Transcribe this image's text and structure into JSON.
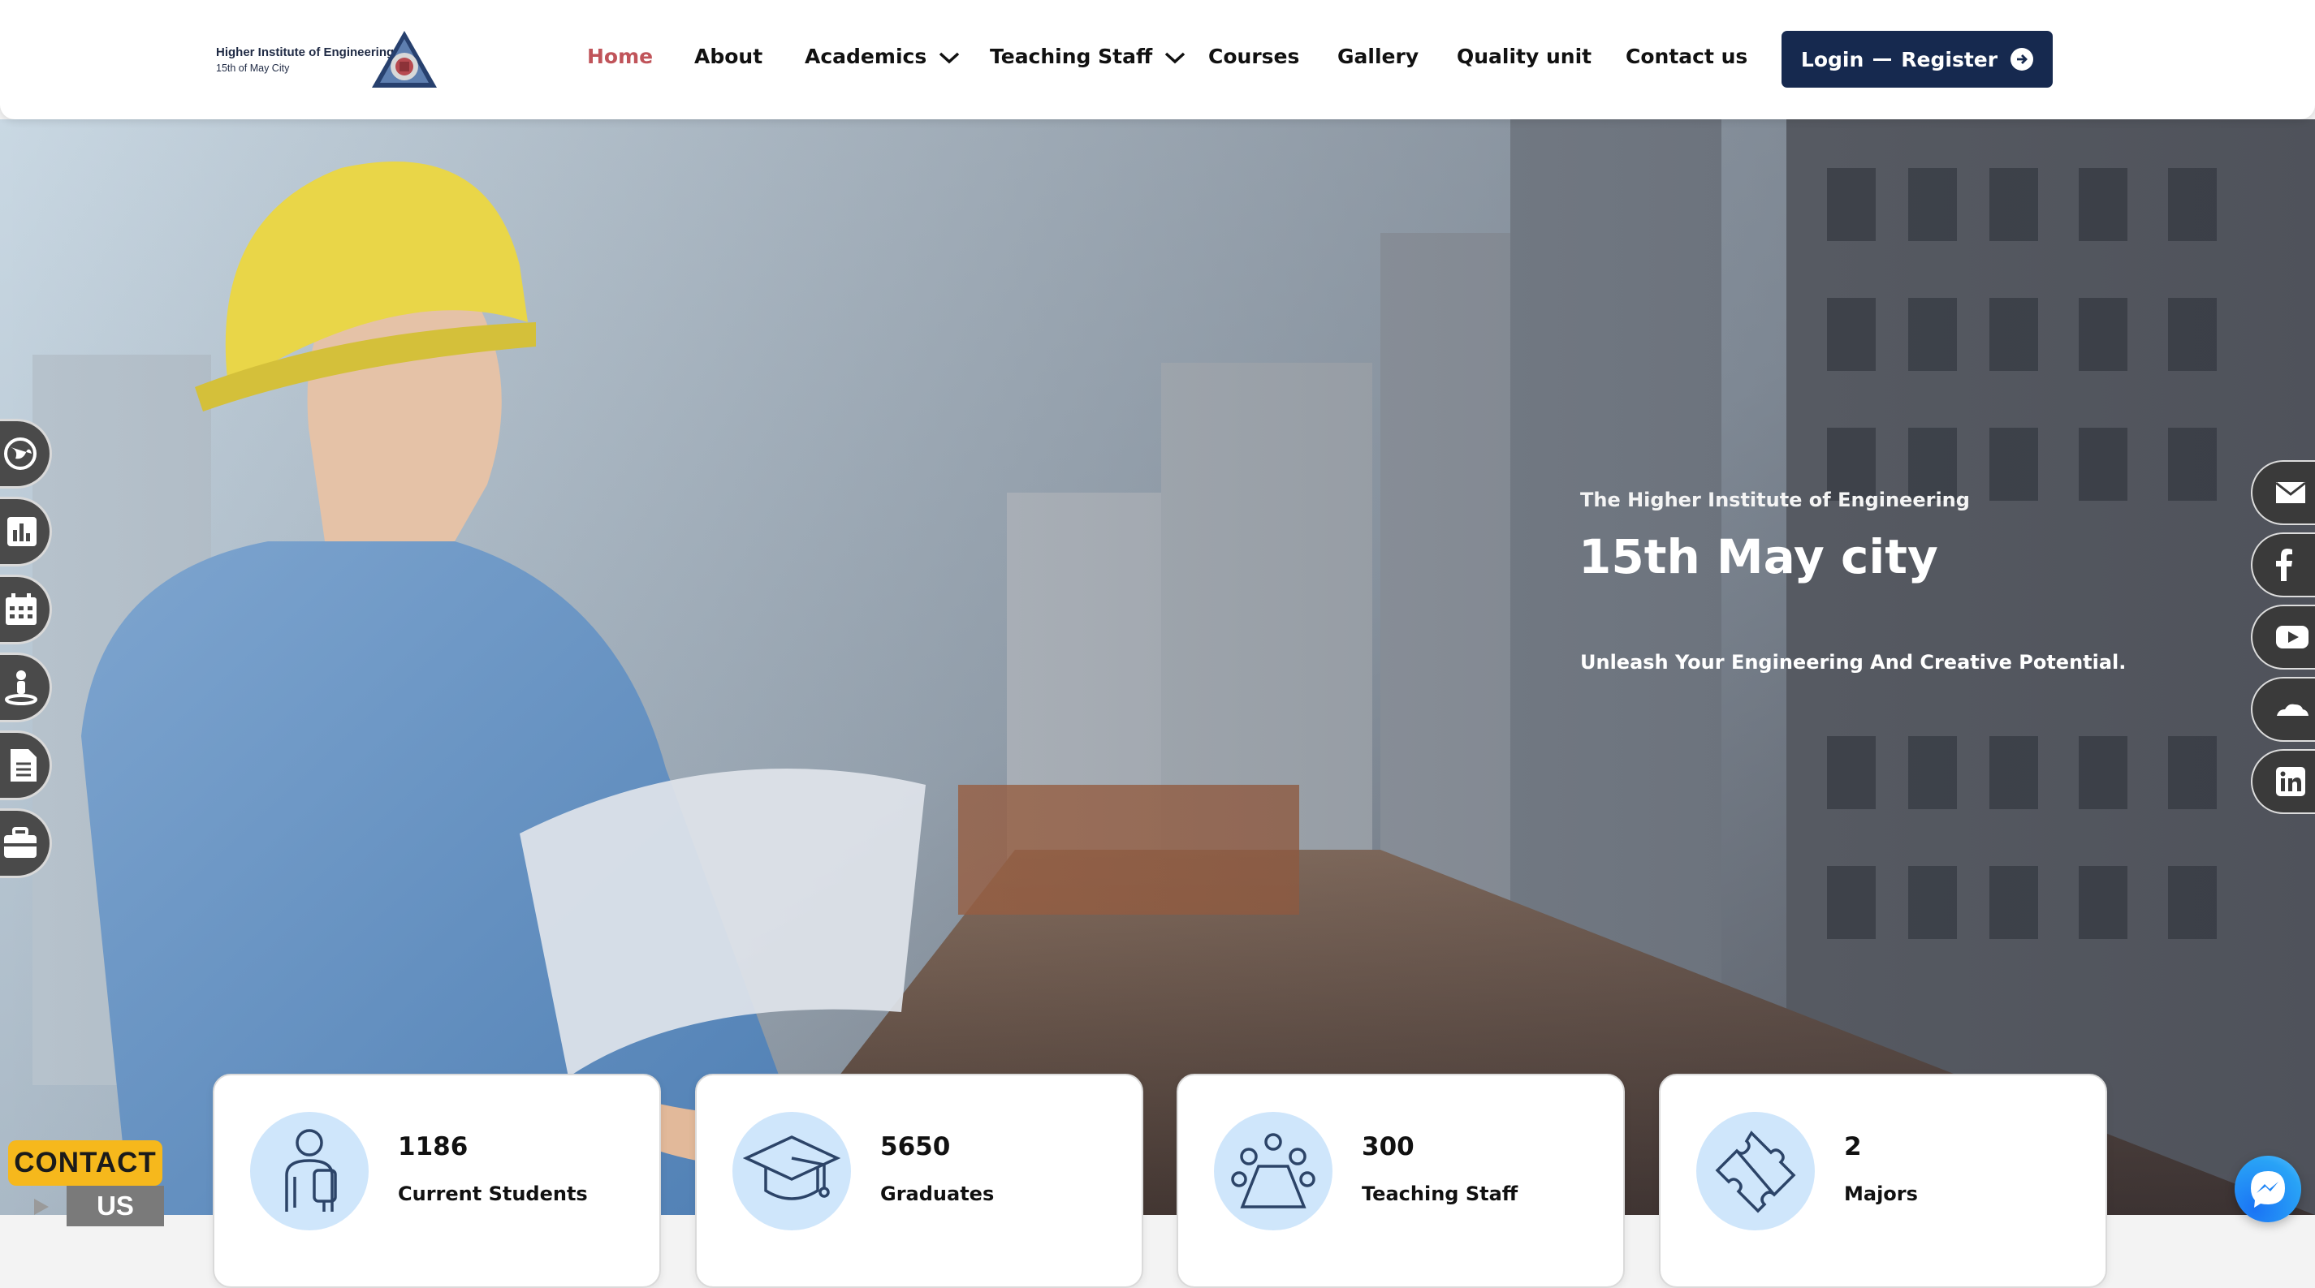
{
  "header": {
    "logo": {
      "line1": "Higher Institute of Engineering",
      "line2": "15th of May City"
    },
    "nav": [
      {
        "label": "Home",
        "active": true
      },
      {
        "label": "About"
      },
      {
        "label": "Academics",
        "has_dropdown": true
      },
      {
        "label": "Teaching Staff",
        "has_dropdown": true
      },
      {
        "label": "Courses"
      },
      {
        "label": "Gallery"
      },
      {
        "label": "Quality unit"
      },
      {
        "label": "Contact us"
      }
    ],
    "login": {
      "login_label": "Login",
      "register_label": "Register",
      "icon": "arrow-right-circle-icon"
    },
    "colors": {
      "active": "#c0545a",
      "button": "#16294f"
    }
  },
  "hero": {
    "subtitle": "The Higher Institute of Engineering",
    "title": "15th May city",
    "tagline": "Unleash Your Engineering And Creative Potential."
  },
  "side_left": [
    {
      "icon": "globe-icon"
    },
    {
      "icon": "bar-chart-icon"
    },
    {
      "icon": "calendar-icon"
    },
    {
      "icon": "person-location-icon"
    },
    {
      "icon": "document-icon"
    },
    {
      "icon": "briefcase-icon"
    }
  ],
  "side_right": [
    {
      "icon": "email-icon"
    },
    {
      "icon": "facebook-icon"
    },
    {
      "icon": "youtube-icon"
    },
    {
      "icon": "cloud-icon"
    },
    {
      "icon": "linkedin-icon"
    }
  ],
  "stats": [
    {
      "value": "1186",
      "label": "Current Students",
      "icon": "student-icon"
    },
    {
      "value": "5650",
      "label": "Graduates",
      "icon": "graduation-cap-icon"
    },
    {
      "value": "300",
      "label": "Teaching Staff",
      "icon": "meeting-icon"
    },
    {
      "value": "2",
      "label": "Majors",
      "icon": "puzzle-icon"
    }
  ],
  "contact_badge": {
    "line1": "CONTACT",
    "line2": "US"
  },
  "messenger": {
    "icon": "messenger-icon"
  }
}
